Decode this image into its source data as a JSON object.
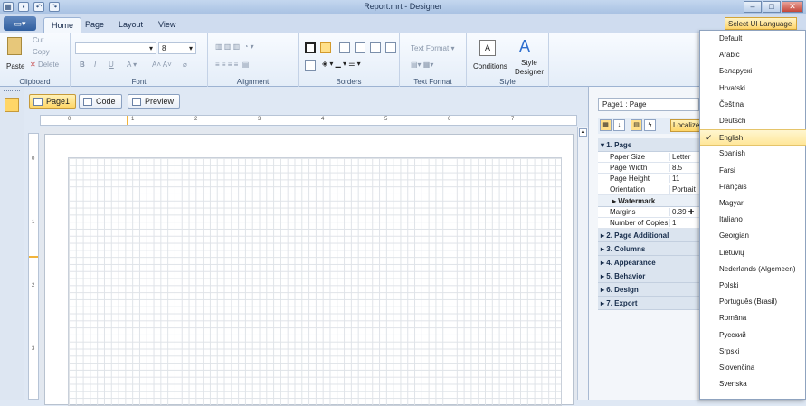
{
  "window": {
    "title": "Report.mrt - Designer",
    "controls": [
      "–",
      "□",
      "✕"
    ]
  },
  "ribbon_tabs": [
    "Home",
    "Page",
    "Layout",
    "View"
  ],
  "language_selector": {
    "label": "Select UI Language"
  },
  "clipboard": {
    "paste": "Paste",
    "cut": "Cut",
    "copy": "Copy",
    "delete": "Delete",
    "group": "Clipboard"
  },
  "font": {
    "size": "8",
    "group": "Font"
  },
  "alignment": {
    "group": "Alignment"
  },
  "borders": {
    "group": "Borders"
  },
  "text_format": {
    "label": "Text Format",
    "group": "Text Format"
  },
  "style": {
    "conditions": "Conditions",
    "style_designer_1": "Style",
    "style_designer_2": "Designer",
    "group": "Style"
  },
  "page_tabs": [
    "Page1",
    "Code",
    "Preview"
  ],
  "ruler": {
    "h_marks": [
      "0",
      "1",
      "2",
      "3",
      "4",
      "5",
      "6",
      "7"
    ],
    "v_marks": [
      "0",
      "1",
      "2",
      "3"
    ]
  },
  "properties": {
    "title": "Page1 : Page",
    "localize": "Localize",
    "sections": [
      {
        "label": "1. Page",
        "expanded": true,
        "rows": [
          {
            "name": "Paper Size",
            "value": "Letter"
          },
          {
            "name": "Page Width",
            "value": "8.5"
          },
          {
            "name": "Page Height",
            "value": "11"
          },
          {
            "name": "Orientation",
            "value": "Portrait"
          }
        ],
        "sub": "Watermark",
        "rows2": [
          {
            "name": "Margins",
            "value": "0.39 ✚"
          },
          {
            "name": "Number of Copies",
            "value": "1"
          }
        ]
      },
      {
        "label": "2. Page  Additional"
      },
      {
        "label": "3. Columns"
      },
      {
        "label": "4. Appearance"
      },
      {
        "label": "5. Behavior"
      },
      {
        "label": "6. Design"
      },
      {
        "label": "7. Export"
      }
    ]
  },
  "languages": {
    "selected": "English",
    "items": [
      "Default",
      "Arabic",
      "Беларускі",
      "Hrvatski",
      "Čeština",
      "Deutsch",
      "English",
      "Spanish",
      "Farsi",
      "Français",
      "Magyar",
      "Italiano",
      "Georgian",
      "Lietuvių",
      "Nederlands (Algemeen)",
      "Polski",
      "Português (Brasil)",
      "Româna",
      "Русский",
      "Srpski",
      "Slovenčina",
      "Svenska"
    ]
  },
  "colors": {
    "accent": "#ffd667",
    "titlebar": "#a9c2e3",
    "ribbon": "#e4edf8"
  }
}
